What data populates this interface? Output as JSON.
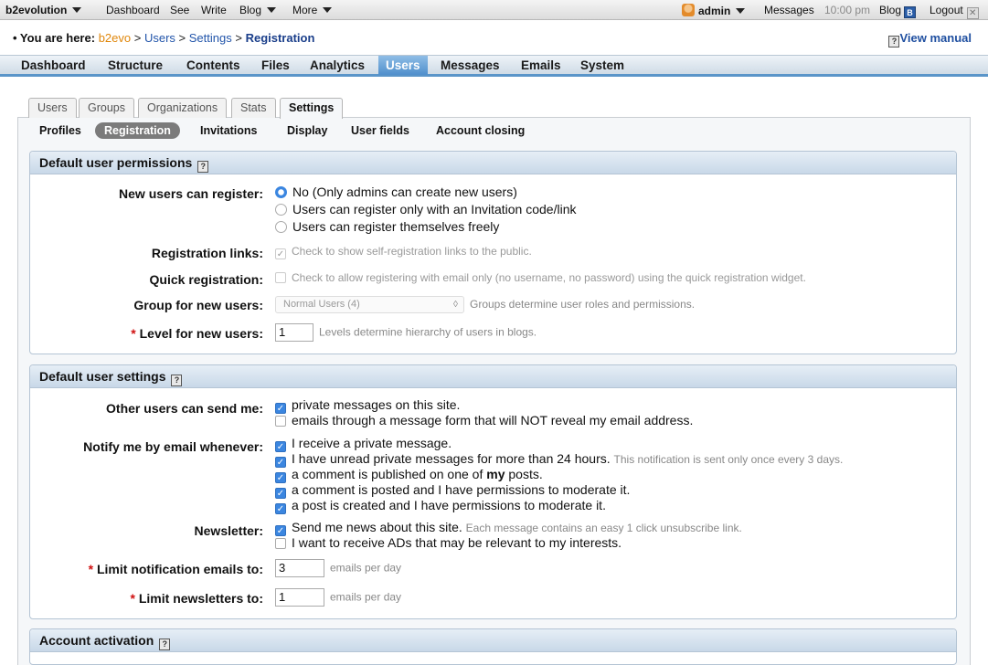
{
  "topbar": {
    "brand": "b2evolution",
    "menu": [
      "Dashboard",
      "See",
      "Write",
      "Blog",
      "More"
    ],
    "user": "admin",
    "messages": "Messages",
    "time": "10:00 pm",
    "blog": "Blog",
    "logout": "Logout",
    "blog_icon_glyph": "B"
  },
  "breadcrumb": {
    "prefix": "• You are here:",
    "items": [
      "b2evo",
      "Users",
      "Settings",
      "Registration"
    ],
    "sep": ">",
    "view_manual": "View manual"
  },
  "mainnav": [
    "Dashboard",
    "Structure",
    "Contents",
    "Files",
    "Analytics",
    "Users",
    "Messages",
    "Emails",
    "System"
  ],
  "mainnav_active": "Users",
  "tabs": [
    "Users",
    "Groups",
    "Organizations",
    "Stats",
    "Settings"
  ],
  "tabs_active": "Settings",
  "subtabs": [
    "Profiles",
    "Registration",
    "Invitations",
    "Display",
    "User fields",
    "Account closing"
  ],
  "subtabs_active": "Registration",
  "permissions": {
    "title": "Default user permissions",
    "register_label": "New users can register:",
    "register_options": [
      "No (Only admins can create new users)",
      "Users can register only with an Invitation code/link",
      "Users can register themselves freely"
    ],
    "reg_links_label": "Registration links:",
    "reg_links_text": "Check to show self-registration links to the public.",
    "quick_label": "Quick registration:",
    "quick_text": "Check to allow registering with email only (no username, no password) using the quick registration widget.",
    "group_label": "Group for new users:",
    "group_value": "Normal Users (4)",
    "group_note": "Groups determine user roles and permissions.",
    "level_label": "Level for new users:",
    "level_value": "1",
    "level_note": "Levels determine hierarchy of users in blogs."
  },
  "settings": {
    "title": "Default user settings",
    "send_label": "Other users can send me:",
    "send_opts": [
      "private messages on this site.",
      "emails through a message form that will NOT reveal my email address."
    ],
    "notify_label": "Notify me by email whenever:",
    "notify_opts": [
      "I receive a private message.",
      "I have unread private messages for more than 24 hours.",
      "a comment is published on one of",
      "a comment is posted and I have permissions to moderate it.",
      "a post is created and I have permissions to moderate it."
    ],
    "notify_note": "This notification is sent only once every 3 days.",
    "my_word": "my",
    "posts_word": "posts.",
    "newsletter_label": "Newsletter:",
    "newsletter_opts": [
      "Send me news about this site.",
      "I want to receive ADs that may be relevant to my interests."
    ],
    "newsletter_note": "Each message contains an easy 1 click unsubscribe link.",
    "limit_notif_label": "Limit notification emails to:",
    "limit_notif_value": "3",
    "limit_news_label": "Limit newsletters to:",
    "limit_news_value": "1",
    "per_day": "emails per day"
  },
  "activation": {
    "title": "Account activation"
  },
  "glyphs": {
    "required": "*",
    "help": "?",
    "check": "✓",
    "logout_x": "✕",
    "select_arrow": "◊"
  },
  "icons": [
    "avatar-icon",
    "blog-icon",
    "logout-icon",
    "help-icon",
    "caret-down-icon"
  ],
  "colors": {
    "accent": "#3b86e0",
    "active_nav": "#4f8fcc",
    "breadcrumb_brand": "#e0870b",
    "required": "#d01010"
  }
}
